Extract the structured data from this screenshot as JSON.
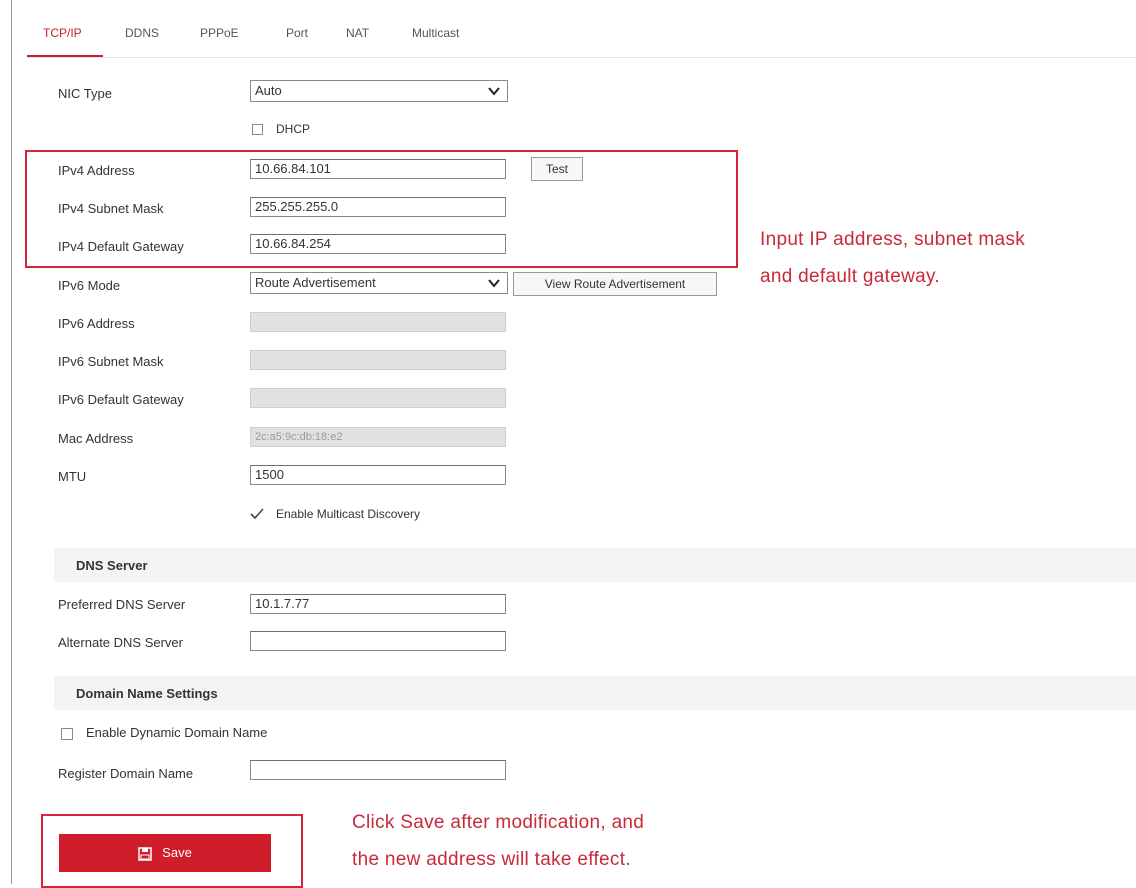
{
  "tabs": [
    "TCP/IP",
    "DDNS",
    "PPPoE",
    "Port",
    "NAT",
    "Multicast"
  ],
  "form": {
    "nic_type": {
      "label": "NIC Type",
      "value": "Auto"
    },
    "dhcp_label": "DHCP",
    "ipv4_address": {
      "label": "IPv4 Address",
      "value": "10.66.84.101"
    },
    "test_button": "Test",
    "ipv4_subnet_mask": {
      "label": "IPv4 Subnet Mask",
      "value": "255.255.255.0"
    },
    "ipv4_default_gateway": {
      "label": "IPv4 Default Gateway",
      "value": "10.66.84.254"
    },
    "ipv6_mode": {
      "label": "IPv6 Mode",
      "value": "Route Advertisement"
    },
    "view_route_button": "View Route Advertisement",
    "ipv6_address": {
      "label": "IPv6 Address",
      "value": ""
    },
    "ipv6_subnet_mask": {
      "label": "IPv6 Subnet Mask",
      "value": ""
    },
    "ipv6_default_gateway": {
      "label": "IPv6 Default Gateway",
      "value": ""
    },
    "mac_address": {
      "label": "Mac Address",
      "value": "2c:a5:9c:db:18:e2"
    },
    "mtu": {
      "label": "MTU",
      "value": "1500"
    },
    "multicast_discovery_label": "Enable Multicast Discovery"
  },
  "dns": {
    "heading": "DNS Server",
    "preferred": {
      "label": "Preferred DNS Server",
      "value": "10.1.7.77"
    },
    "alternate": {
      "label": "Alternate DNS Server",
      "value": ""
    }
  },
  "domain": {
    "heading": "Domain Name Settings",
    "enable_dynamic_label": "Enable Dynamic Domain Name",
    "register": {
      "label": "Register Domain Name",
      "value": ""
    }
  },
  "save_label": "Save",
  "annotations": {
    "ip_note_line1": "Input IP address, subnet mask",
    "ip_note_line2": "and default gateway.",
    "save_note_line1": "Click Save after modification, and",
    "save_note_line2": "the new address will take effect."
  },
  "colors": {
    "accent": "#c61f2b",
    "highlight_box": "#d6253a",
    "save_button": "#cf1d2b"
  }
}
